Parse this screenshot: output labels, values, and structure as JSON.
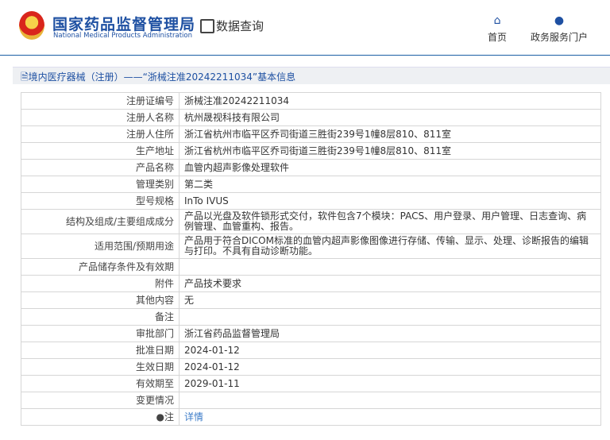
{
  "header": {
    "brand_cn": "国家药品监督管理局",
    "brand_en": "National Medical Products Administration",
    "query_label": "数据查询",
    "nav": [
      {
        "icon": "home-icon",
        "label": "首页"
      },
      {
        "icon": "user-icon",
        "label": "政务服务门户"
      }
    ]
  },
  "title": "境内医疗器械（注册）——“浙械注准20242211034”基本信息",
  "rows": [
    {
      "label": "注册证编号",
      "value": "浙械注准20242211034"
    },
    {
      "label": "注册人名称",
      "value": "杭州晟视科技有限公司"
    },
    {
      "label": "注册人住所",
      "value": "浙江省杭州市临平区乔司街道三胜街239号1幢8层810、811室"
    },
    {
      "label": "生产地址",
      "value": "浙江省杭州市临平区乔司街道三胜街239号1幢8层810、811室"
    },
    {
      "label": "产品名称",
      "value": "血管内超声影像处理软件"
    },
    {
      "label": "管理类别",
      "value": "第二类"
    },
    {
      "label": "型号规格",
      "value": "InTo IVUS"
    },
    {
      "label": "结构及组成/主要组成成分",
      "value": "产品以光盘及软件锁形式交付，软件包含7个模块：PACS、用户登录、用户管理、日志查询、病例管理、血管重构、报告。"
    },
    {
      "label": "适用范围/预期用途",
      "value": "产品用于符合DICOM标准的血管内超声影像图像进行存储、传输、显示、处理、诊断报告的编辑与打印。不具有自动诊断功能。"
    },
    {
      "label": "产品储存条件及有效期",
      "value": ""
    },
    {
      "label": "附件",
      "value": "产品技术要求"
    },
    {
      "label": "其他内容",
      "value": "无"
    },
    {
      "label": "备注",
      "value": ""
    },
    {
      "label": "审批部门",
      "value": "浙江省药品监督管理局"
    },
    {
      "label": "批准日期",
      "value": "2024-01-12"
    },
    {
      "label": "生效日期",
      "value": "2024-01-12"
    },
    {
      "label": "有效期至",
      "value": "2029-01-11"
    },
    {
      "label": "变更情况",
      "value": ""
    }
  ],
  "note": {
    "label": "注",
    "link": "详情"
  }
}
